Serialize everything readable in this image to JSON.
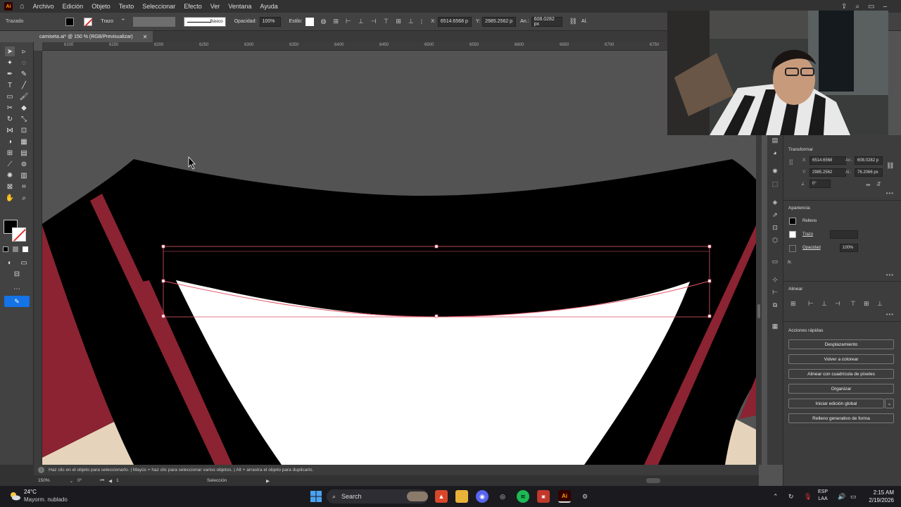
{
  "app": {
    "logo": "Ai",
    "menu": [
      "Archivo",
      "Edición",
      "Objeto",
      "Texto",
      "Seleccionar",
      "Efecto",
      "Ver",
      "Ventana",
      "Ayuda"
    ]
  },
  "control": {
    "selection_label": "Trazado",
    "stroke_label": "Trazo",
    "stroke_profile": "Básico",
    "opacity_label": "Opacidad:",
    "opacity_value": "100%",
    "style_label": "Estilo:",
    "x_label": "X:",
    "x_value": "6514.6568 p",
    "y_label": "Y:",
    "y_value": "2985.2562 p",
    "w_label": "An.:",
    "w_value": "608.0282 px",
    "al_label": "Al."
  },
  "document": {
    "tab_title": "camiseta.ai* @ 150 % (RGB/Previsualizar)"
  },
  "ruler": {
    "labels": [
      "6100",
      "6150",
      "6200",
      "6250",
      "6300",
      "6350",
      "6400",
      "6450",
      "6500",
      "6550",
      "6600",
      "6650",
      "6700",
      "6750"
    ]
  },
  "status": {
    "hint": "Haz clic en el objeto para seleccionarlo.  |  Mayús + haz clic para seleccionar varios objetos.  |  Alt + arrastra el objeto para duplicarlo.",
    "zoom": "150%",
    "rotation": "0°",
    "artboard": "1",
    "mode": "Selección"
  },
  "panels": {
    "transform": {
      "title": "Transformar",
      "x_label": "X:",
      "x": "6514.6568",
      "y_label": "Y:",
      "y": "2985.2562",
      "w_label": "An.:",
      "w": "608.0282 p",
      "h_label": "Al.:",
      "h": "76.2066 px",
      "angle": "0°"
    },
    "appearance": {
      "title": "Apariencia",
      "fill": "Relleno",
      "stroke": "Trazo",
      "opacity": "Opacidad",
      "opacity_value": "100%",
      "fx": "fx."
    },
    "align": {
      "title": "Alinear"
    },
    "quick_actions": {
      "title": "Acciones rápidas",
      "buttons": [
        "Desplazamiento",
        "Volver a colorear",
        "Alinear con cuadrícula de píxeles",
        "Organizar",
        "Iniciar edición global",
        "Relleno generativo de forma"
      ]
    }
  },
  "taskbar": {
    "temp": "24°C",
    "weather": "Mayorm. nublado",
    "search": "Search",
    "lang_1": "ESP",
    "lang_2": "LAA",
    "time": "2:15 AM",
    "date": "2/19/2026"
  },
  "colors": {
    "jersey_black": "#000000",
    "jersey_red": "#8b2332",
    "skin": "#e6d3bb",
    "selection": "#e05a6a"
  }
}
